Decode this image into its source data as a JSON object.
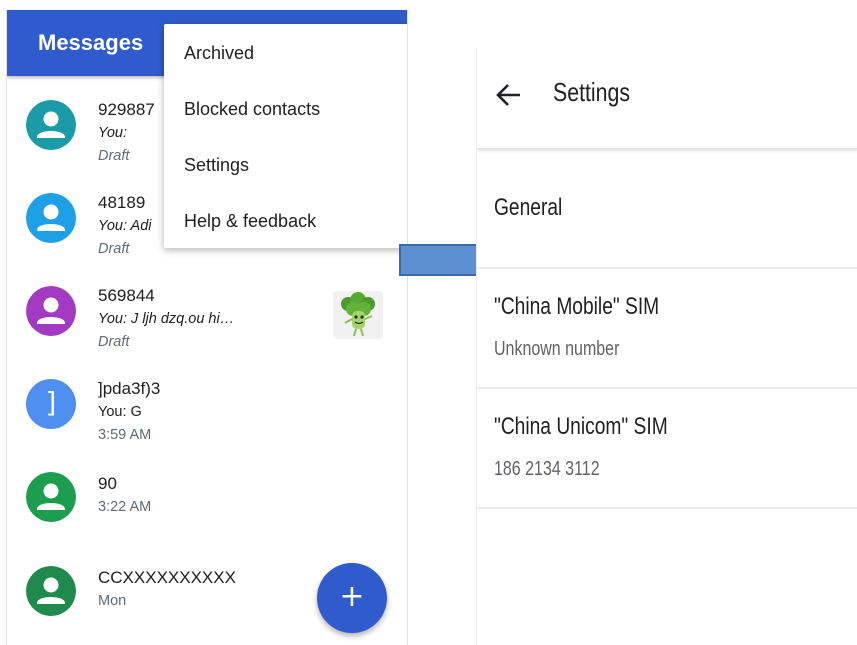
{
  "messages": {
    "title": "Messages",
    "menu": {
      "items": [
        {
          "label": "Archived"
        },
        {
          "label": "Blocked contacts"
        },
        {
          "label": "Settings"
        },
        {
          "label": "Help & feedback"
        }
      ]
    },
    "conversations": [
      {
        "name": "929887",
        "snippet": "You:",
        "meta": "Draft",
        "avatar_color": "#1a9ba7",
        "avatar_icon": "person-icon"
      },
      {
        "name": "48189",
        "snippet": "You: Adi",
        "meta": "Draft",
        "avatar_color": "#1ea0e6",
        "avatar_icon": "person-icon"
      },
      {
        "name": "569844",
        "snippet": "You: J ljh dzq.ou hi…",
        "meta": "Draft",
        "avatar_color": "#a23bc2",
        "avatar_icon": "person-icon",
        "attachment_icon": "broccoli-sticker-icon"
      },
      {
        "name": "]pda3f)3",
        "snippet": "You: G",
        "meta": "3:59 AM",
        "avatar_color": "#4f8ff0",
        "avatar_glyph": "]"
      },
      {
        "name": "90",
        "snippet": "",
        "meta": "3:22 AM",
        "avatar_color": "#1d9e4e",
        "avatar_icon": "person-icon"
      },
      {
        "name": "CCXXXXXXXXXX",
        "snippet": "",
        "meta": "Mon",
        "avatar_color": "#1f8a4c",
        "avatar_icon": "person-icon"
      }
    ],
    "fab": {
      "label": "+",
      "icon": "plus-icon"
    },
    "accent_color": "#2f5bcc"
  },
  "settings": {
    "title": "Settings",
    "back_icon": "arrow-back-icon",
    "general": "General",
    "sims": [
      {
        "title": "\"China Mobile\" SIM",
        "subtitle": "Unknown number"
      },
      {
        "title": "\"China Unicom\" SIM",
        "subtitle": "186 2134 3112"
      }
    ]
  },
  "arrow": {
    "fill": "#5b8fd0",
    "stroke": "#3b6aa8"
  }
}
